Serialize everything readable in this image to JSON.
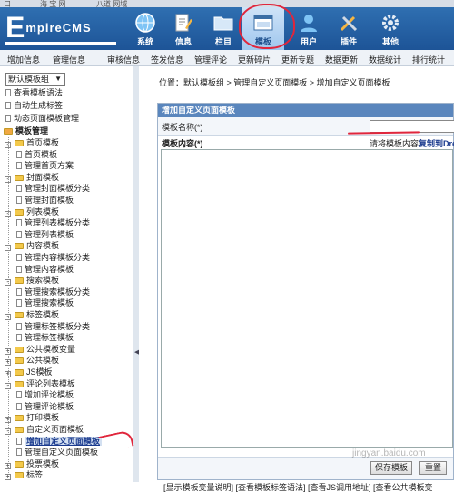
{
  "top_strip": [
    "口",
    "海 宝 网",
    "八道 网域"
  ],
  "logo": {
    "text": "EmpireCMS",
    "first": "E",
    "rest": "mpireCMS"
  },
  "nav": [
    {
      "label": "系统",
      "icon": "globe-icon"
    },
    {
      "label": "信息",
      "icon": "document-pen-icon"
    },
    {
      "label": "栏目",
      "icon": "folder-icon"
    },
    {
      "label": "模板",
      "icon": "template-window-icon",
      "active": true
    },
    {
      "label": "用户",
      "icon": "user-icon"
    },
    {
      "label": "插件",
      "icon": "tools-icon"
    },
    {
      "label": "其他",
      "icon": "gear-icon"
    }
  ],
  "menubar": [
    "增加信息",
    "管理信息",
    "审核信息",
    "签发信息",
    "管理评论",
    "更新碎片",
    "更新专题",
    "数据更新",
    "数据统计",
    "排行统计"
  ],
  "sidebar": {
    "select_value": "默认模板组",
    "top_links": [
      "查看模板语法",
      "自动生成标签",
      "动态页面模板管理"
    ],
    "section_title": "模板管理",
    "tree": [
      {
        "label": "首页模板",
        "level": 0,
        "kind": "folder",
        "expand": "-"
      },
      {
        "label": "首页模板",
        "level": 1,
        "kind": "doc"
      },
      {
        "label": "管理首页方案",
        "level": 1,
        "kind": "doc"
      },
      {
        "label": "封面模板",
        "level": 0,
        "kind": "folder",
        "expand": "-"
      },
      {
        "label": "管理封面模板分类",
        "level": 1,
        "kind": "doc"
      },
      {
        "label": "管理封面模板",
        "level": 1,
        "kind": "doc"
      },
      {
        "label": "列表模板",
        "level": 0,
        "kind": "folder",
        "expand": "-"
      },
      {
        "label": "管理列表模板分类",
        "level": 1,
        "kind": "doc"
      },
      {
        "label": "管理列表模板",
        "level": 1,
        "kind": "doc"
      },
      {
        "label": "内容模板",
        "level": 0,
        "kind": "folder",
        "expand": "-"
      },
      {
        "label": "管理内容模板分类",
        "level": 1,
        "kind": "doc"
      },
      {
        "label": "管理内容模板",
        "level": 1,
        "kind": "doc"
      },
      {
        "label": "搜索模板",
        "level": 0,
        "kind": "folder",
        "expand": "-"
      },
      {
        "label": "管理搜索模板分类",
        "level": 1,
        "kind": "doc"
      },
      {
        "label": "管理搜索模板",
        "level": 1,
        "kind": "doc"
      },
      {
        "label": "标签模板",
        "level": 0,
        "kind": "folder",
        "expand": "-"
      },
      {
        "label": "管理标签模板分类",
        "level": 1,
        "kind": "doc"
      },
      {
        "label": "管理标签模板",
        "level": 1,
        "kind": "doc"
      },
      {
        "label": "公共模板变量",
        "level": 0,
        "kind": "folder",
        "expand": "+"
      },
      {
        "label": "公共模板",
        "level": 0,
        "kind": "folder",
        "expand": "+"
      },
      {
        "label": "JS模板",
        "level": 0,
        "kind": "folder",
        "expand": "+"
      },
      {
        "label": "评论列表模板",
        "level": 0,
        "kind": "folder",
        "expand": "-"
      },
      {
        "label": "增加评论模板",
        "level": 1,
        "kind": "doc"
      },
      {
        "label": "管理评论模板",
        "level": 1,
        "kind": "doc"
      },
      {
        "label": "打印模板",
        "level": 0,
        "kind": "folder",
        "expand": "+"
      },
      {
        "label": "自定义页面模板",
        "level": 0,
        "kind": "folder",
        "expand": "-"
      },
      {
        "label": "增加自定义页面模板",
        "level": 1,
        "kind": "doc",
        "selected": true
      },
      {
        "label": "管理自定义页面模板",
        "level": 1,
        "kind": "doc"
      },
      {
        "label": "投票模板",
        "level": 0,
        "kind": "folder",
        "expand": "+"
      },
      {
        "label": "标签",
        "level": 0,
        "kind": "folder",
        "expand": "+"
      }
    ]
  },
  "main": {
    "breadcrumb": "位置：默认模板组 > 管理自定义页面模板 > 增加自定义页面模板",
    "panel_title": "增加自定义页面模板",
    "name_label": "模板名称(*)",
    "content_label": "模板内容(*)",
    "hint_prefix": "请将模板内容",
    "hint_link": "复制到Dre",
    "save_button": "保存模板",
    "reset_button": "重置",
    "bottom_links": "[显示模板变量说明] [查看模板标签语法] [查看JS调用地址] [查看公共模板变"
  },
  "watermark": "jingyan.baidu.com",
  "colors": {
    "header": "#2f6fb1",
    "panel_head": "#5a86bd",
    "annotation": "#e0263c"
  }
}
